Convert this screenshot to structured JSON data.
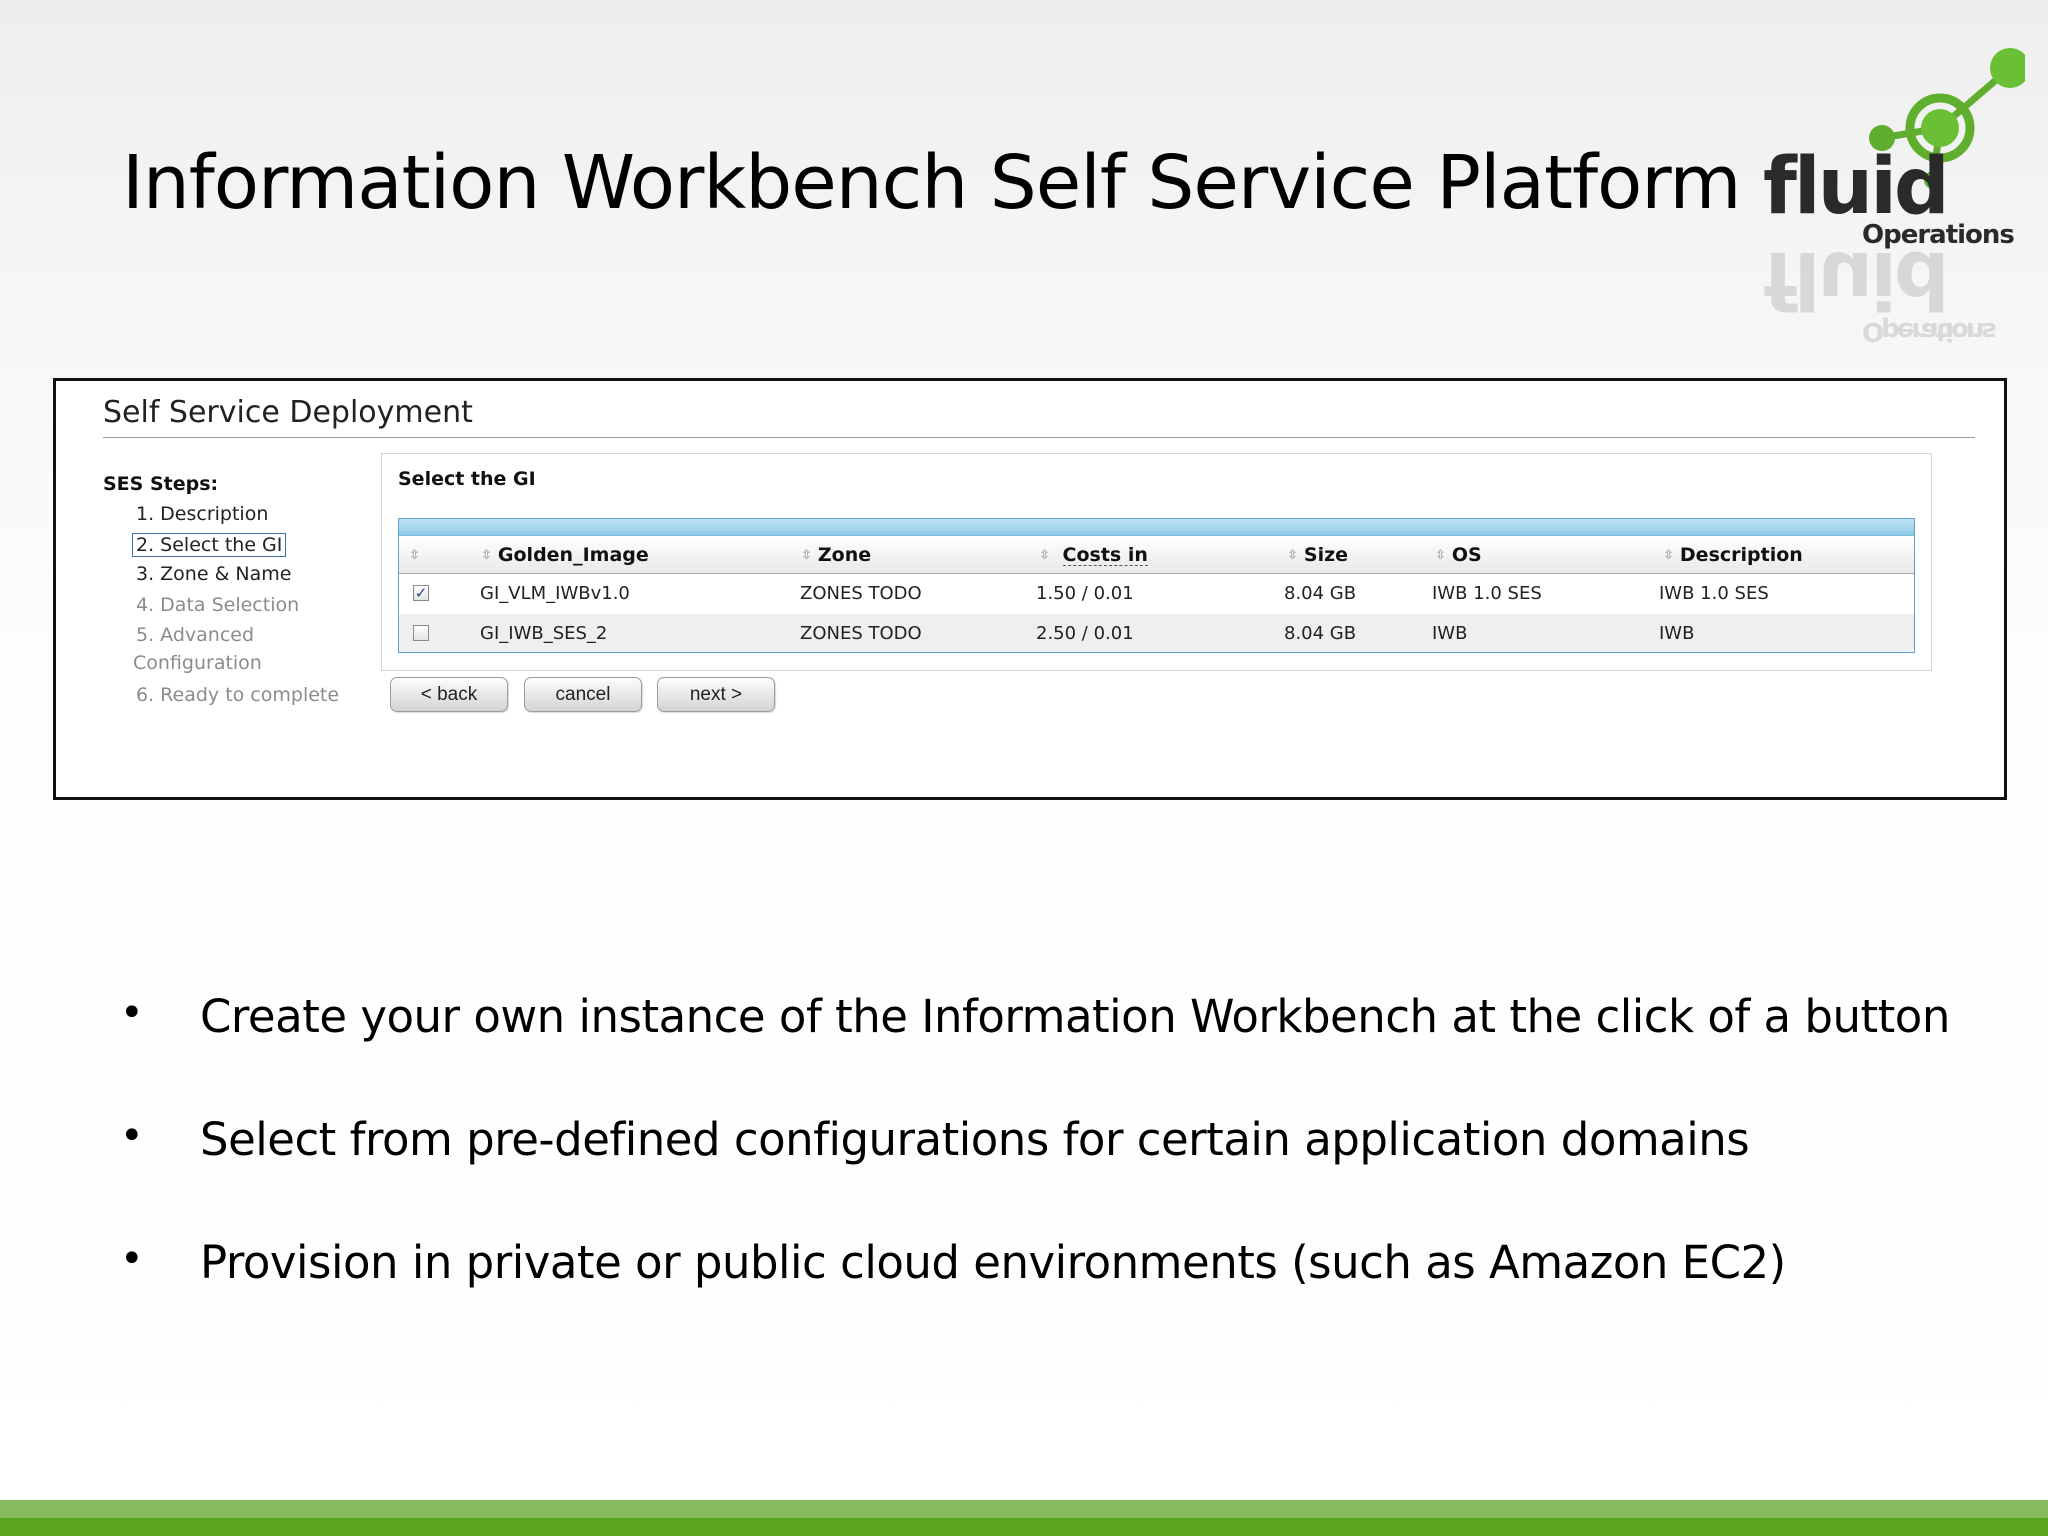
{
  "slide": {
    "title": "Information Workbench Self Service Platform"
  },
  "logo": {
    "word": "fluid",
    "sub": "Operations",
    "accent": "#5fae2e"
  },
  "panel": {
    "title": "Self Service Deployment",
    "steps_title": "SES Steps:",
    "steps": [
      {
        "label": "1. Description",
        "state": "done"
      },
      {
        "label": "2. Select the GI",
        "state": "current"
      },
      {
        "label": "3. Zone & Name",
        "state": "enabled"
      },
      {
        "label": "4. Data Selection",
        "state": "disabled"
      },
      {
        "label": "5. Advanced",
        "state": "disabled"
      },
      {
        "label": "Configuration",
        "state": "disabled"
      },
      {
        "label": "6. Ready to complete",
        "state": "disabled"
      }
    ],
    "content_title": "Select the GI",
    "columns": [
      "Golden_Image",
      "Zone",
      "Costs in",
      "Size",
      "OS",
      "Description"
    ],
    "rows": [
      {
        "checked": true,
        "golden_image": "GI_VLM_IWBv1.0",
        "zone": "ZONES TODO",
        "costs": "1.50 / 0.01",
        "size": "8.04 GB",
        "os": "IWB 1.0 SES",
        "description": "IWB 1.0 SES"
      },
      {
        "checked": false,
        "golden_image": "GI_IWB_SES_2",
        "zone": "ZONES TODO",
        "costs": "2.50 / 0.01",
        "size": "8.04 GB",
        "os": "IWB",
        "description": "IWB"
      }
    ],
    "buttons": {
      "back": "< back",
      "cancel": "cancel",
      "next": "next >"
    }
  },
  "bullets": [
    "Create your own instance of the Information Workbench at the click of a button",
    "Select from pre-defined configurations for certain application domains",
    "Provision in private or public cloud environments (such as Amazon EC2)"
  ],
  "colors": {
    "grid_bar": "#8fcbe9",
    "footer_light": "#86bb5e",
    "footer_dark": "#5aa61f"
  }
}
